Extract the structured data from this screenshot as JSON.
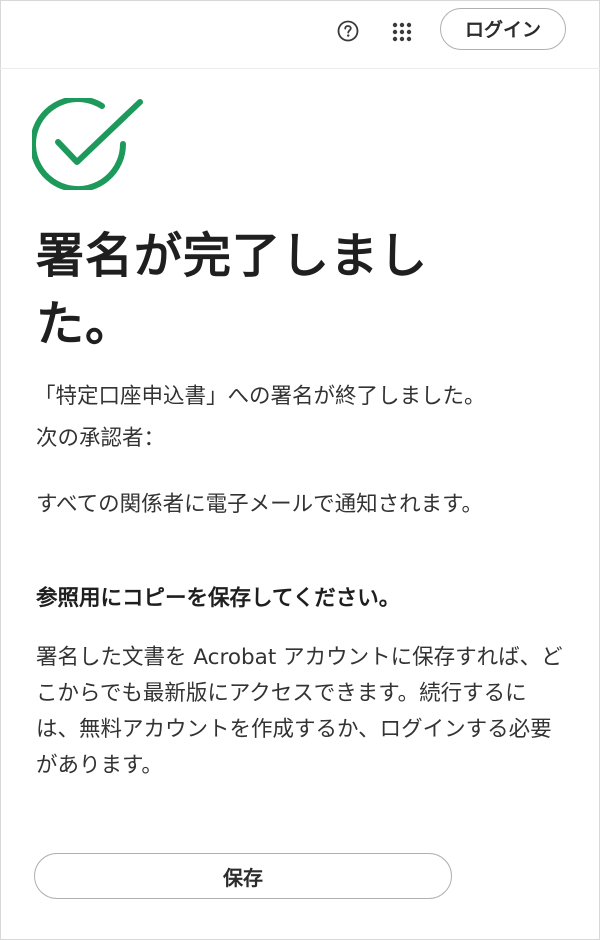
{
  "header": {
    "help_icon": "question-circle-icon",
    "apps_icon": "apps-grid-icon",
    "login_label": "ログイン"
  },
  "status": {
    "icon": "check-circle-icon",
    "icon_color": "#1d9a5b",
    "title": "署名が完了しました。"
  },
  "body": {
    "signed_message": "「特定口座申込書」への署名が終了しました。",
    "next_approver_label": "次の承認者：",
    "notify_message": "すべての関係者に電子メールで通知されます。",
    "save_copy_heading": "参照用にコピーを保存してください。",
    "save_description": "署名した文書を Acrobat アカウントに保存すれば、どこからでも最新版にアクセスできます。続行するには、無料アカウントを作成するか、ログインする必要があります。"
  },
  "actions": {
    "save_label": "保存"
  }
}
